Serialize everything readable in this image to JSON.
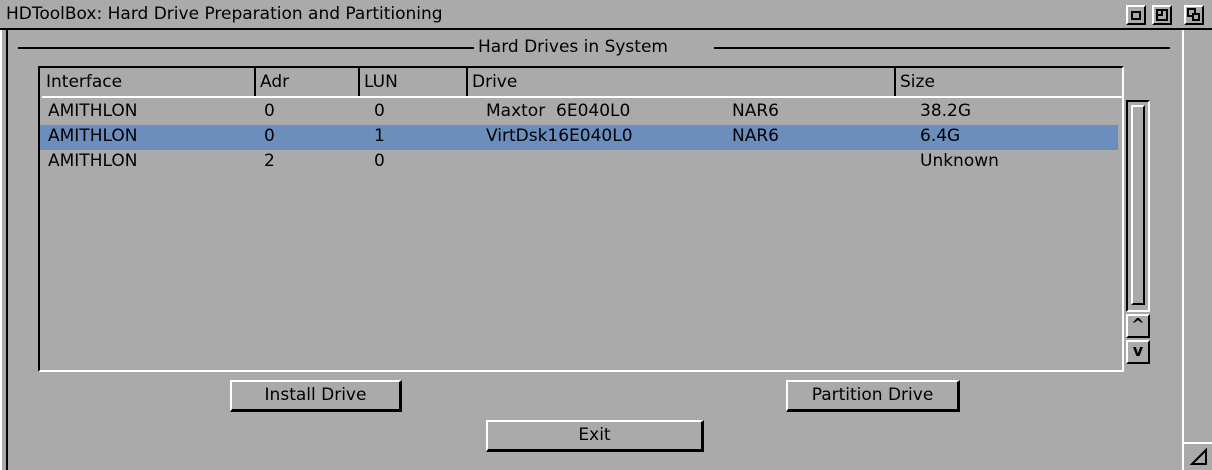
{
  "window": {
    "title": "HDToolBox: Hard Drive Preparation and Partitioning"
  },
  "group": {
    "title": "Hard Drives in System"
  },
  "list": {
    "columns": [
      "Interface",
      "Adr",
      "LUN",
      "Drive",
      "Size"
    ],
    "rows": [
      {
        "interface": "AMITHLON",
        "adr": "0",
        "lun": "0",
        "drive": "Maxtor  6E040L0",
        "rev": "NAR6",
        "size": "38.2G",
        "selected": false
      },
      {
        "interface": "AMITHLON",
        "adr": "0",
        "lun": "1",
        "drive": "VirtDsk16E040L0",
        "rev": "NAR6",
        "size": "6.4G",
        "selected": true
      },
      {
        "interface": "AMITHLON",
        "adr": "2",
        "lun": "0",
        "drive": "",
        "rev": "",
        "size": "Unknown",
        "selected": false
      }
    ],
    "selection_color": "#6b8ebd"
  },
  "scrollbar": {
    "up_label": "^",
    "down_label": "v"
  },
  "buttons": {
    "install": "Install Drive",
    "partition": "Partition Drive",
    "exit": "Exit"
  },
  "icons": {
    "depth_gadget": "depth-icon",
    "zoom_gadget": "zoom-icon",
    "iconify_gadget": "iconify-icon",
    "size_gadget": "resize-icon"
  }
}
